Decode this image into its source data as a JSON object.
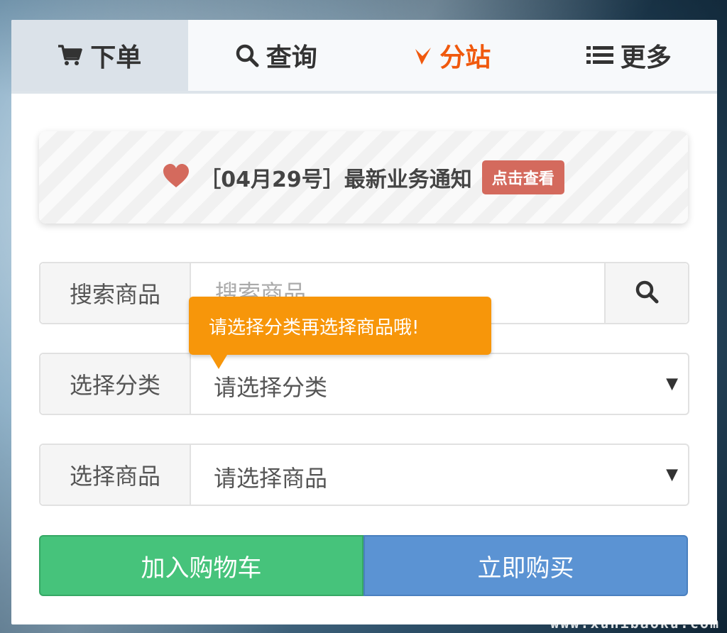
{
  "tabs": [
    {
      "label": "下单",
      "icon": "cart-icon"
    },
    {
      "label": "查询",
      "icon": "search-icon"
    },
    {
      "label": "分站",
      "icon": "chevron-down-icon"
    },
    {
      "label": "更多",
      "icon": "list-icon"
    }
  ],
  "notice": {
    "icon": "heart-icon",
    "text": "［04月29号］最新业务通知",
    "badge": "点击查看"
  },
  "search": {
    "label": "搜索商品",
    "placeholder": "搜索商品",
    "button_icon": "search-icon"
  },
  "tooltip": {
    "text": "请选择分类再选择商品哦!"
  },
  "category": {
    "label": "选择分类",
    "selected": "请选择分类"
  },
  "product": {
    "label": "选择商品",
    "selected": "请选择商品"
  },
  "actions": {
    "add_to_cart": "加入购物车",
    "buy_now": "立即购买"
  },
  "watermark": "www.xunibaoku.com",
  "colors": {
    "accent_orange": "#f0590e",
    "tooltip_orange": "#f7960a",
    "badge_red": "#d46a5d",
    "heart_red": "#d46a5d",
    "green": "#46c37b",
    "blue": "#5b93d3"
  }
}
